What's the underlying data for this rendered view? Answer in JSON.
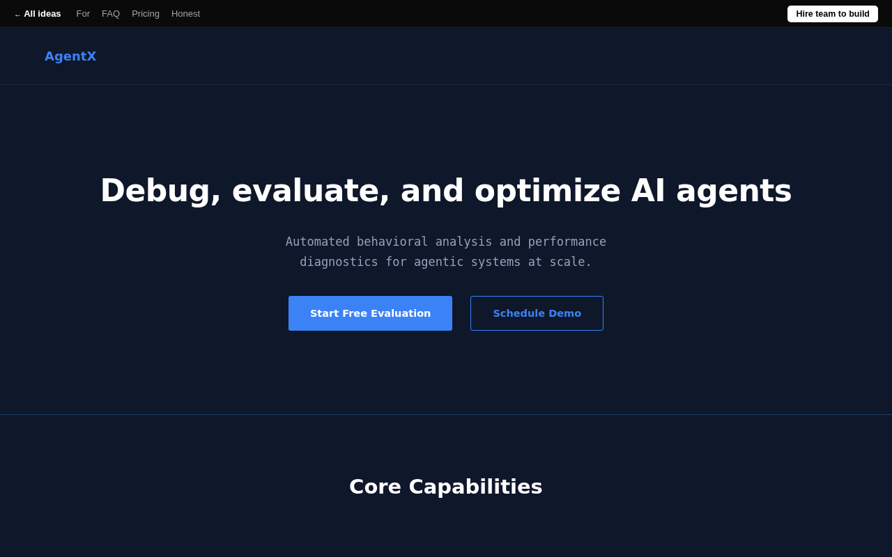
{
  "top_bar": {
    "back_link": {
      "arrow": "←",
      "label": "All ideas"
    },
    "links": [
      "For",
      "FAQ",
      "Pricing",
      "Honest"
    ],
    "cta": "Hire team to build"
  },
  "header": {
    "logo": "AgentX"
  },
  "hero": {
    "title": "Debug, evaluate, and optimize AI agents",
    "subtitle": "Automated behavioral analysis and performance diagnostics for agentic systems at scale.",
    "buttons": [
      {
        "label": "Start Free Evaluation",
        "kind": "primary"
      },
      {
        "label": "Schedule Demo",
        "kind": "secondary"
      }
    ]
  },
  "capabilities": {
    "heading": "Core Capabilities"
  }
}
